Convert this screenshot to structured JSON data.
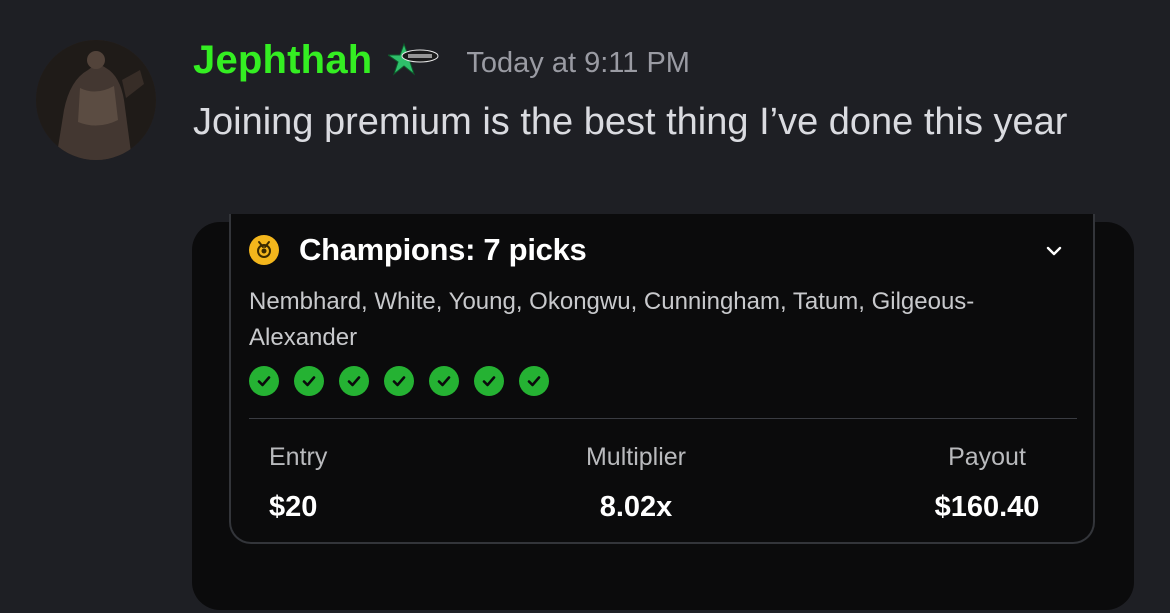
{
  "message": {
    "author": "Jephthah",
    "author_color": "#34ee22",
    "badge_icon": "star-badge-icon",
    "timestamp": "Today at 9:11 PM",
    "text": "Joining premium is the best thing I’ve done this year"
  },
  "card": {
    "medal_icon": "gold-medal-icon",
    "title": "Champions: 7 picks",
    "players": "Nembhard, White, Young, Okongwu, Cunningham, Tatum, Gilgeous-Alexander",
    "check_icon": "green-checkmark-icon",
    "check_count": 7,
    "stats": {
      "entry_label": "Entry",
      "entry_value": "$20",
      "multiplier_label": "Multiplier",
      "multiplier_value": "8.02x",
      "payout_label": "Payout",
      "payout_value": "$160.40"
    }
  }
}
